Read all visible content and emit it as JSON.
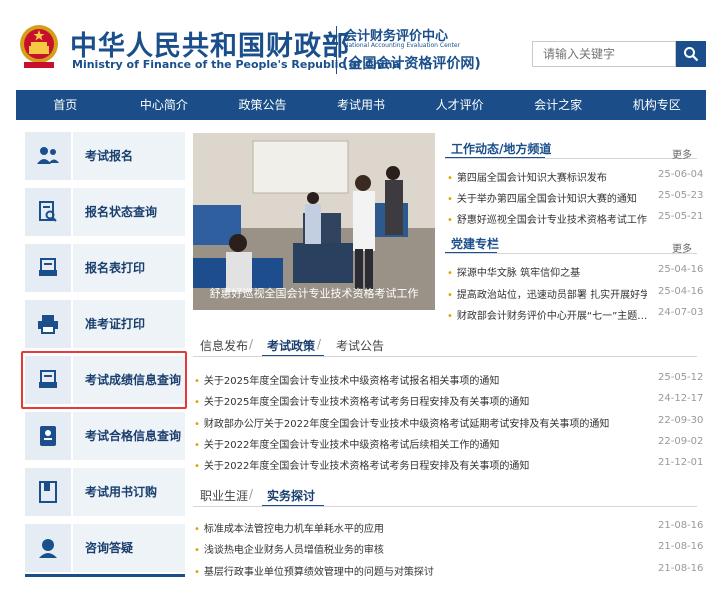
{
  "header": {
    "title_cn": "中华人民共和国财政部",
    "title_en": "Ministry of Finance of the People's Republic of China",
    "center_cn": "会计财务评价中心",
    "center_en": "National Accounting Evaluation Center",
    "center_net": "(全国会计资格评价网)",
    "search_placeholder": "请输入关键字",
    "search_icon": "search-icon"
  },
  "nav": [
    "首页",
    "中心简介",
    "政策公告",
    "考试用书",
    "人才评价",
    "会计之家",
    "机构专区"
  ],
  "sidebar": [
    {
      "label": "考试报名",
      "icon": "people-icon"
    },
    {
      "label": "报名状态查询",
      "icon": "document-search-icon"
    },
    {
      "label": "报名表打印",
      "icon": "form-print-icon"
    },
    {
      "label": "准考证打印",
      "icon": "printer-icon"
    },
    {
      "label": "考试成绩信息查询",
      "icon": "score-document-icon"
    },
    {
      "label": "考试合格信息查询",
      "icon": "certificate-icon"
    },
    {
      "label": "考试用书订购",
      "icon": "book-icon"
    },
    {
      "label": "咨询答疑",
      "icon": "support-person-icon"
    }
  ],
  "photo": {
    "caption": "舒惠好巡视全国会计专业技术资格考试工作"
  },
  "work_news": {
    "title": "工作动态/地方频道",
    "more": "更多",
    "items": [
      {
        "text": "第四届全国会计知识大赛标识发布",
        "date": "25-06-04"
      },
      {
        "text": "关于举办第四届全国会计知识大赛的通知",
        "date": "25-05-23"
      },
      {
        "text": "舒惠好巡视全国会计专业技术资格考试工作",
        "date": "25-05-21"
      }
    ]
  },
  "party": {
    "title": "党建专栏",
    "more": "更多",
    "items": [
      {
        "text": "探源中华文脉 筑牢信仰之基",
        "date": "25-04-16"
      },
      {
        "text": "提高政治站位，迅速动员部署 扎实开展好学…",
        "date": "25-04-16"
      },
      {
        "text": "财政部会计财务评价中心开展“七一”主题…",
        "date": "24-07-03"
      }
    ]
  },
  "policy_tabs": {
    "tabs": [
      "信息发布",
      "考试政策",
      "考试公告"
    ],
    "items": [
      {
        "text": "关于2025年度全国会计专业技术中级资格考试报名相关事项的通知",
        "date": "25-05-12"
      },
      {
        "text": "关于2025年度全国会计专业技术资格考试考务日程安排及有关事项的通知",
        "date": "24-12-17"
      },
      {
        "text": "财政部办公厅关于2022年度全国会计专业技术中级资格考试延期考试安排及有关事项的通知",
        "date": "22-09-30"
      },
      {
        "text": "关于2022年度全国会计专业技术中级资格考试后续相关工作的通知",
        "date": "22-09-02"
      },
      {
        "text": "关于2022年度全国会计专业技术资格考试考务日程安排及有关事项的通知",
        "date": "21-12-01"
      }
    ]
  },
  "practice_tabs": {
    "tabs": [
      "职业生涯",
      "实务探讨"
    ],
    "items": [
      {
        "text": "标准成本法管控电力机车单耗水平的应用",
        "date": "21-08-16"
      },
      {
        "text": "浅谈热电企业财务人员增值税业务的审核",
        "date": "21-08-16"
      },
      {
        "text": "基层行政事业单位预算绩效管理中的问题与对策探讨",
        "date": "21-08-16"
      }
    ]
  },
  "colors": {
    "brand": "#1a4f8c",
    "nav": "#1b4e88",
    "highlight": "#e53935",
    "bullet": "#e0a000"
  }
}
